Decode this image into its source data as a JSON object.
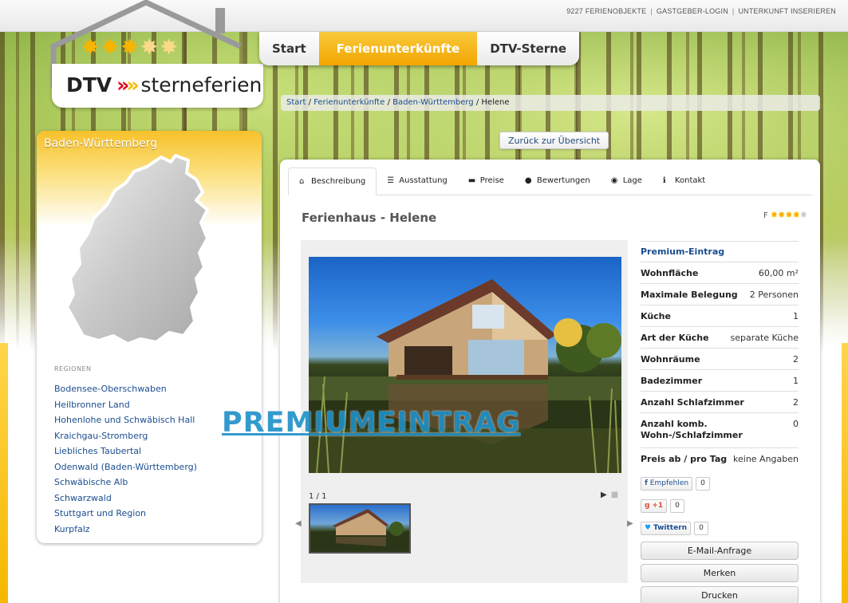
{
  "topbar": {
    "count_link": "9227 FERIENOBJEKTE",
    "host_login": "GASTGEBER-LOGIN",
    "list_property": "UNTERKUNFT INSERIEREN",
    "separator": "|"
  },
  "logo": {
    "text_left": "DTV",
    "chevrons": "»",
    "text_right": "sterneferien",
    "stars_full": 3,
    "stars_light": 2
  },
  "mainnav": {
    "items": [
      {
        "label": "Start"
      },
      {
        "label": "Ferienunterkünfte"
      },
      {
        "label": "DTV-Sterne"
      }
    ],
    "active_index": 1
  },
  "breadcrumb": {
    "items": [
      "Start",
      "Ferienunterkünfte",
      "Baden-Württemberg",
      "Helene"
    ],
    "separator": "/"
  },
  "back_button": "Zurück zur Übersicht",
  "sidebar": {
    "title": "Baden-Württemberg",
    "regions_label": "REGIONEN",
    "regions": [
      "Bodensee-Oberschwaben",
      "Heilbronner Land",
      "Hohenlohe und Schwäbisch Hall",
      "Kraichgau-Stromberg",
      "Liebliches Taubertal",
      "Odenwald (Baden-Württemberg)",
      "Schwäbische Alb",
      "Schwarzwald",
      "Stuttgart und Region",
      "Kurpfalz"
    ]
  },
  "tabs": [
    {
      "label": "Beschreibung",
      "icon": "home-icon",
      "glyph": "⌂"
    },
    {
      "label": "Ausstattung",
      "icon": "list-icon",
      "glyph": "☰"
    },
    {
      "label": "Preise",
      "icon": "briefcase-icon",
      "glyph": "▬"
    },
    {
      "label": "Bewertungen",
      "icon": "user-icon",
      "glyph": "●"
    },
    {
      "label": "Lage",
      "icon": "map-marker-icon",
      "glyph": "◉"
    },
    {
      "label": "Kontakt",
      "icon": "info-icon",
      "glyph": "ℹ"
    }
  ],
  "listing": {
    "title": "Ferienhaus - Helene",
    "rating_prefix": "F",
    "rating_full": 4,
    "rating_total": 5,
    "image_counter": "1 / 1",
    "play_glyph": "▶",
    "stop_glyph": "■",
    "prev_glyph": "◀",
    "next_glyph": "▶"
  },
  "details": {
    "premium_label": "Premium-Eintrag",
    "rows": [
      {
        "key": "Wohnfläche",
        "value": "60,00 m²"
      },
      {
        "key": "Maximale Belegung",
        "value": "2 Personen"
      },
      {
        "key": "Küche",
        "value": "1"
      },
      {
        "key": "Art der Küche",
        "value": "separate Küche"
      },
      {
        "key": "Wohnräume",
        "value": "2"
      },
      {
        "key": "Badezimmer",
        "value": "1"
      },
      {
        "key": "Anzahl Schlafzimmer",
        "value": "2"
      },
      {
        "key": "Anzahl komb. Wohn-/Schlafzimmer",
        "value": "0"
      },
      {
        "key": "Preis ab / pro Tag",
        "value": "keine Angaben"
      }
    ]
  },
  "social": {
    "facebook_label": "Empfehlen",
    "facebook_count": "0",
    "google_label": "+1",
    "google_count": "0",
    "twitter_label": "Twittern",
    "twitter_count": "0"
  },
  "actions": {
    "email": "E-Mail-Anfrage",
    "save": "Merken",
    "print": "Drucken"
  },
  "watermark": "PREMIUMEINTRAG",
  "colors": {
    "accent_yellow": "#f2a600",
    "link_blue": "#1a4d8f",
    "watermark_blue": "#1e90c8",
    "star_gold": "#f7b500"
  }
}
